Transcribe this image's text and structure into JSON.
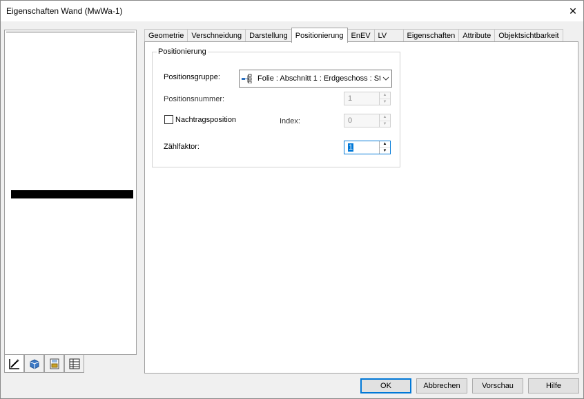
{
  "window": {
    "title": "Eigenschaften Wand (MwWa-1)",
    "close_glyph": "✕"
  },
  "tabs": [
    {
      "label": "Geometrie"
    },
    {
      "label": "Verschneidung"
    },
    {
      "label": "Darstellung"
    },
    {
      "label": "Positionierung",
      "active": true
    },
    {
      "label": "EnEV"
    },
    {
      "label": "LV"
    },
    {
      "label": "Eigenschaften"
    },
    {
      "label": "Attribute"
    },
    {
      "label": "Objektsichtbarkeit"
    }
  ],
  "panel": {
    "group_title": "Positionierung",
    "positionsgruppe": {
      "label": "Positionsgruppe:",
      "value": "Folie : Abschnitt 1 : Erdgeschoss : St",
      "icon": "hierarchy-icon"
    },
    "positionsnummer": {
      "label": "Positionsnummer:",
      "value": "1",
      "enabled": false
    },
    "nachtragsposition": {
      "label": "Nachtragsposition",
      "checked": false
    },
    "index": {
      "label": "Index:",
      "value": "0",
      "enabled": false
    },
    "zaehlfaktor": {
      "label": "Zählfaktor:",
      "value": "1",
      "enabled": true
    }
  },
  "view_tabs": [
    {
      "icon": "edit-icon",
      "active": true
    },
    {
      "icon": "3d-view-icon"
    },
    {
      "icon": "print-preview-icon"
    },
    {
      "icon": "table-icon"
    }
  ],
  "buttons": {
    "ok": "OK",
    "cancel": "Abbrechen",
    "preview": "Vorschau",
    "help": "Hilfe"
  },
  "colors": {
    "accent": "#0078d7",
    "window_bg": "#f0f0f0"
  }
}
